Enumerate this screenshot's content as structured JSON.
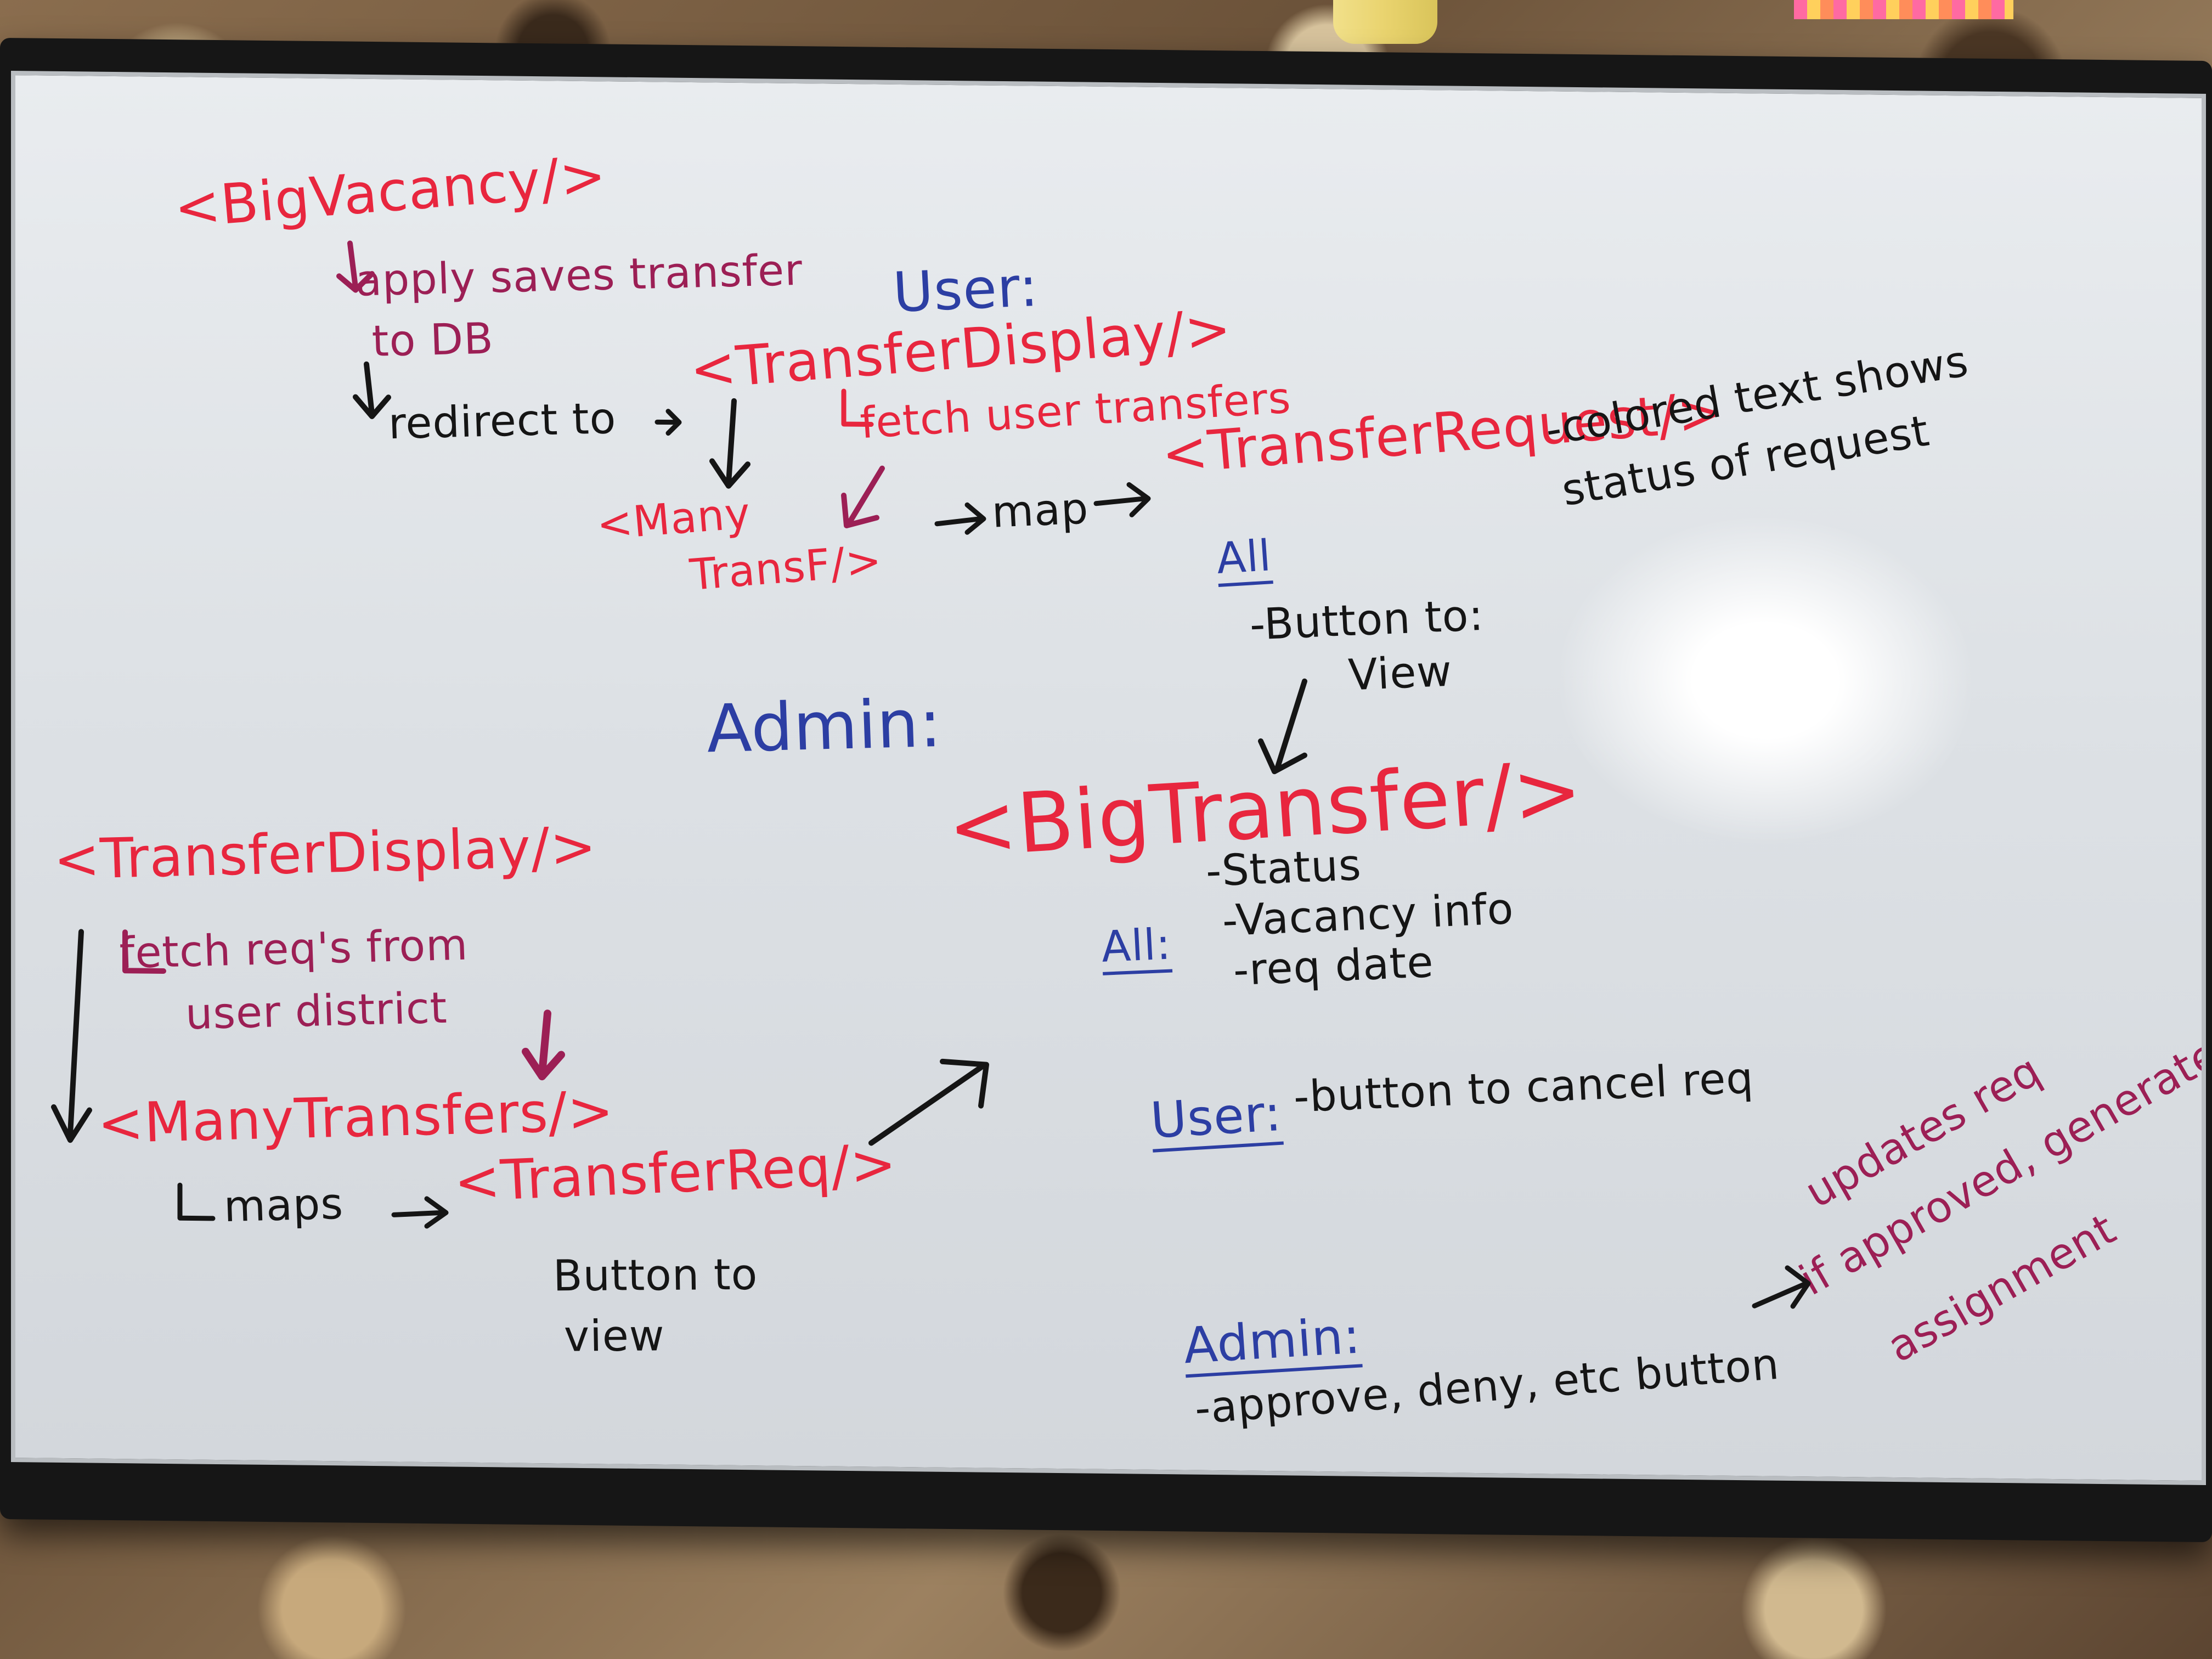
{
  "whiteboard": {
    "lines": [
      {
        "key": "big_vacancy",
        "text": "<BigVacancy/>"
      },
      {
        "key": "apply_saves",
        "text": "apply saves transfer"
      },
      {
        "key": "to_db",
        "text": "to DB"
      },
      {
        "key": "user_heading",
        "text": "User:"
      },
      {
        "key": "redirect",
        "text": "redirect to"
      },
      {
        "key": "transfer_display_1",
        "text": "<TransferDisplay/>"
      },
      {
        "key": "fetch_user_transfers",
        "text": "fetch user transfers"
      },
      {
        "key": "many_1",
        "text": "<Many"
      },
      {
        "key": "many_2",
        "text": "TransF/>"
      },
      {
        "key": "map",
        "text": "map"
      },
      {
        "key": "transfer_request",
        "text": "<TransferRequest/>"
      },
      {
        "key": "colored_1",
        "text": "-colored text shows"
      },
      {
        "key": "colored_2",
        "text": "status of request"
      },
      {
        "key": "all_1",
        "text": "All"
      },
      {
        "key": "button_to_view_1",
        "text": "-Button to:"
      },
      {
        "key": "view_1",
        "text": "View"
      },
      {
        "key": "admin_heading",
        "text": "Admin:"
      },
      {
        "key": "big_transfer",
        "text": "<BigTransfer/>"
      },
      {
        "key": "status",
        "text": "-Status"
      },
      {
        "key": "vacancy_info",
        "text": "-Vacancy info"
      },
      {
        "key": "req_date",
        "text": "-req date"
      },
      {
        "key": "all_2",
        "text": "All:"
      },
      {
        "key": "transfer_display_2",
        "text": "<TransferDisplay/>"
      },
      {
        "key": "fetch_reqs_1",
        "text": "fetch req's from"
      },
      {
        "key": "fetch_reqs_2",
        "text": "user district"
      },
      {
        "key": "many_transfers",
        "text": "<ManyTransfers/>"
      },
      {
        "key": "maps",
        "text": "maps"
      },
      {
        "key": "transfer_req",
        "text": "<TransferReq/>"
      },
      {
        "key": "button_to_view_2",
        "text": "Button to"
      },
      {
        "key": "view_2",
        "text": "view"
      },
      {
        "key": "user_heading_2",
        "text": "User:"
      },
      {
        "key": "cancel_req",
        "text": "-button to cancel req"
      },
      {
        "key": "admin_heading_2",
        "text": "Admin:"
      },
      {
        "key": "approve_deny",
        "text": "-approve, deny, etc button"
      },
      {
        "key": "updates_1",
        "text": "updates req"
      },
      {
        "key": "updates_2",
        "text": "if approved, generate"
      },
      {
        "key": "updates_3",
        "text": "assignment"
      }
    ]
  },
  "colors": {
    "red_marker": "#e8263e",
    "black_marker": "#151515",
    "blue_marker": "#2c3ea3",
    "plum_marker": "#9c1f55"
  }
}
